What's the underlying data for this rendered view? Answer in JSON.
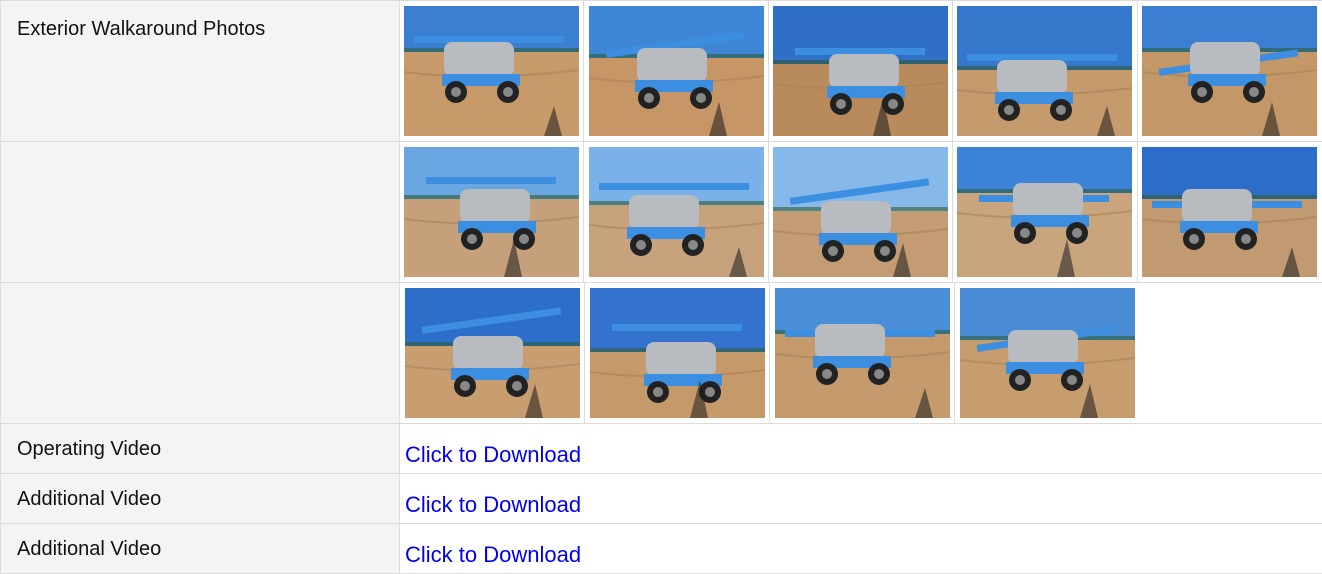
{
  "walkaround": {
    "label": "Exterior Walkaround Photos",
    "rows": [
      [
        {
          "icon": "photo-lift-rear-icon",
          "sky": "#3a7fd0",
          "ground": "#c79a6a"
        },
        {
          "icon": "photo-lift-rear-quarter-icon",
          "sky": "#3f86d6",
          "ground": "#c79666"
        },
        {
          "icon": "photo-lift-front-wheel-icon",
          "sky": "#2f6fc6",
          "ground": "#b98a5c"
        },
        {
          "icon": "photo-lift-side-boom-icon",
          "sky": "#3577cb",
          "ground": "#c59a6c"
        },
        {
          "icon": "photo-boom-side-icon",
          "sky": "#3a7fd2",
          "ground": "#c49769"
        }
      ],
      [
        {
          "icon": "photo-basket-platform-icon",
          "sky": "#6aa6e2",
          "ground": "#c6a07a"
        },
        {
          "icon": "photo-basket-front-icon",
          "sky": "#7ab1e8",
          "ground": "#c8a27c"
        },
        {
          "icon": "photo-basket-angle-icon",
          "sky": "#86b8ea",
          "ground": "#c49c74"
        },
        {
          "icon": "photo-boom-lowered-icon",
          "sky": "#3d84d8",
          "ground": "#c9a57e"
        },
        {
          "icon": "photo-boom-closeup-icon",
          "sky": "#2c6dc8",
          "ground": "#c29a72"
        }
      ],
      [
        {
          "icon": "photo-s125-side-icon",
          "sky": "#2d6ecb",
          "ground": "#c89e70"
        },
        {
          "icon": "photo-s125-closeup-icon",
          "sky": "#3373cd",
          "ground": "#c59a6b"
        },
        {
          "icon": "photo-front-quarter-icon",
          "sky": "#4a8ed8",
          "ground": "#c59b6d"
        },
        {
          "icon": "photo-front-angle-icon",
          "sky": "#4a8cd6",
          "ground": "#c79d6f"
        }
      ]
    ]
  },
  "videos": [
    {
      "label": "Operating Video",
      "link": "Click to Download"
    },
    {
      "label": "Additional Video",
      "link": "Click to Download"
    },
    {
      "label": "Additional Video",
      "link": "Click to Download"
    }
  ],
  "colors": {
    "link": "#0000ee",
    "label_bg": "#f4f4f4",
    "border": "#dcdcdc",
    "lift_blue": "#3b8ee0",
    "chassis_gray": "#b8bcc0"
  }
}
